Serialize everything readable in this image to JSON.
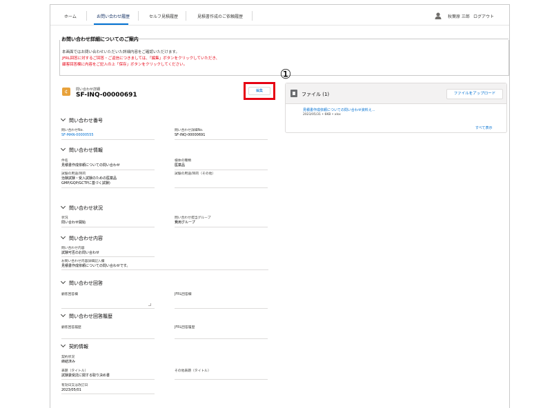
{
  "nav": {
    "items": [
      "ホーム",
      "お問い合わせ履歴",
      "セルフ見積履歴",
      "見積書作成のご依頼履歴"
    ],
    "user_name": "秋葉原 三郎",
    "logout": "ログアウト"
  },
  "notice": {
    "title": "お問い合わせ詳細についてのご案内",
    "lines": [
      "本画面ではお問い合わせいただいた詳細内容をご確認いただけます。",
      "JFRL回答に対するご回答・ご返信につきましては、「編集」ボタンをクリックしていただき、",
      "顧客回答欄に内容をご記入の上「保存」ボタンをクリックしてください。"
    ]
  },
  "record": {
    "label": "問い合わせ詳細",
    "name": "SF-INQ-00000691",
    "edit_label": "編集",
    "callout": "①"
  },
  "files": {
    "title": "ファイル (1)",
    "upload_label": "ファイルをアップロード",
    "file_name": "見積書作成依頼についての問い合わせ資料え...",
    "file_meta": "2023/05/31 • 6KB • xlsx",
    "show_all": "すべて表示"
  },
  "sections": {
    "s1": "問い合わせ番号",
    "s2": "問い合わせ情報",
    "s3": "問い合わせ状況",
    "s4": "問い合わせ内容",
    "s5": "問い合わせ回答",
    "s6": "問い合わせ回答履歴",
    "s7": "契約情報"
  },
  "fields": {
    "inquiry_no_label": "問い合わせNo.",
    "inquiry_no_value": "SF-MAN-00000555",
    "detail_no_label": "問い合わせ詳細No.",
    "detail_no_value": "SF-INQ-00000691",
    "subject_label": "件名",
    "subject_value": "見積書作成依頼についての問い合わせ",
    "sample_type_label": "検体の種類",
    "sample_type_value": "医薬品",
    "purpose_label": "試験の用途/目的",
    "purpose_value1": "治験試験・受入試験のための医薬品",
    "purpose_value2": "GMP/GQP/GCTPに基づく試験)",
    "purpose_other_label": "試験の用途/目的（その他）",
    "purpose_other_value": "",
    "status_label": "状況",
    "status_value": "問い合わせ開始",
    "group_label": "問い合わせ担当グループ",
    "group_value": "費用グループ",
    "content_label": "問い合わせ内容",
    "content_value": "試験可否のお問い合わせ",
    "content_detail_label": "お問い合わせ内容詳細記入欄",
    "content_detail_value": "見積書作成依頼についての問い合わせです。",
    "customer_answer_label": "顧客回答欄",
    "customer_answer_value": "",
    "jfrl_answer_label": "JFRL回答欄",
    "jfrl_answer_value": "",
    "customer_history_label": "顧客回答履歴",
    "customer_history_value": "",
    "jfrl_history_label": "JFRL回答履歴",
    "jfrl_history_value": "",
    "contract_status_label": "契約状況",
    "contract_status_value": "締結済み",
    "title_label": "表題（タイトル）",
    "title_value": "試験委受託に関する取り決め書",
    "other_title_label": "その他表題（タイトル）",
    "other_title_value": "",
    "date_label": "有効日又は改訂日",
    "date_value": "2023/05/01"
  },
  "colors": {
    "accent": "#0070d2",
    "notice_red": "#e60012",
    "record_icon": "#e8a23b"
  }
}
